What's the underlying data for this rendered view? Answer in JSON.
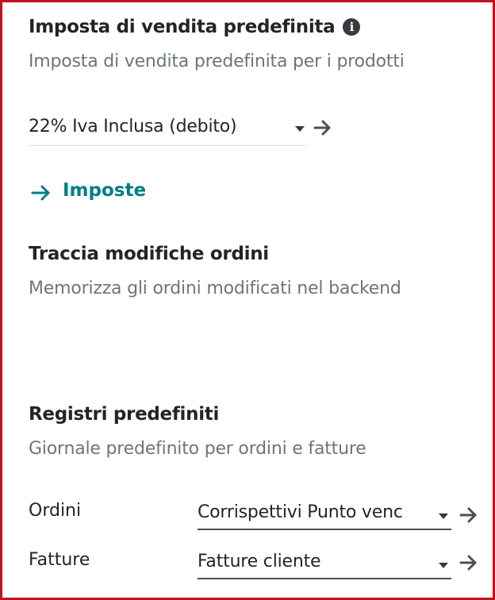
{
  "sales_tax": {
    "title": "Imposta di vendita predefinita",
    "description": "Imposta di vendita predefinita per i prodotti",
    "value": "22% Iva Inclusa (debito)",
    "link_label": "Imposte"
  },
  "track_orders": {
    "title": "Traccia modifiche ordini",
    "description": "Memorizza gli ordini modificati nel backend"
  },
  "default_journals": {
    "title": "Registri predefiniti",
    "description": "Giornale predefinito per ordini e fatture",
    "orders_label": "Ordini",
    "orders_value": "Corrispettivi Punto venc",
    "invoices_label": "Fatture",
    "invoices_value": "Fatture cliente"
  },
  "colors": {
    "accent": "#017e84",
    "border": "#c1121f"
  },
  "icons": [
    "info-icon",
    "caret-down-icon",
    "arrow-right-icon"
  ]
}
